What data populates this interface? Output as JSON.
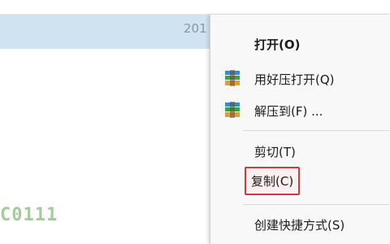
{
  "explorer": {
    "date_fragment": "201",
    "filename_fragment": "C0111"
  },
  "context_menu": {
    "items": [
      {
        "label": "打开(O)",
        "bold": true,
        "icon": null
      },
      {
        "label": "用好压打开(Q)",
        "icon": "winrar-archive-icon"
      },
      {
        "label": "解压到(F) ...",
        "icon": "winrar-archive-icon"
      },
      {
        "label": "剪切(T)"
      },
      {
        "label": "复制(C)",
        "highlighted": true
      },
      {
        "label": "创建快捷方式(S)"
      }
    ]
  },
  "colors": {
    "selection": "#cfe3f1",
    "highlight_border": "#d23a43",
    "menu_bg": "#f8f8f8"
  }
}
